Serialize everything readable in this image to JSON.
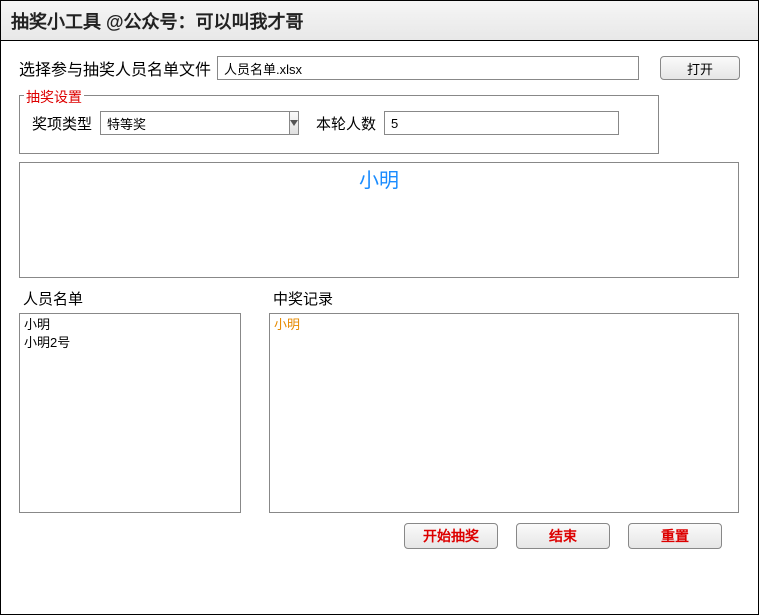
{
  "window": {
    "title": "抽奖小工具 @公众号：可以叫我才哥"
  },
  "file": {
    "label": "选择参与抽奖人员名单文件",
    "value": "人员名单.xlsx",
    "open_label": "打开"
  },
  "settings": {
    "legend": "抽奖设置",
    "prize_type_label": "奖项类型",
    "prize_type_value": "特等奖",
    "count_label": "本轮人数",
    "count_value": "5"
  },
  "display": {
    "current_name": "小明"
  },
  "participants": {
    "label": "人员名单",
    "items": [
      "小明",
      "小明2号"
    ]
  },
  "winners": {
    "label": "中奖记录",
    "items": [
      "小明"
    ]
  },
  "buttons": {
    "start": "开始抽奖",
    "end": "结束",
    "reset": "重置"
  }
}
